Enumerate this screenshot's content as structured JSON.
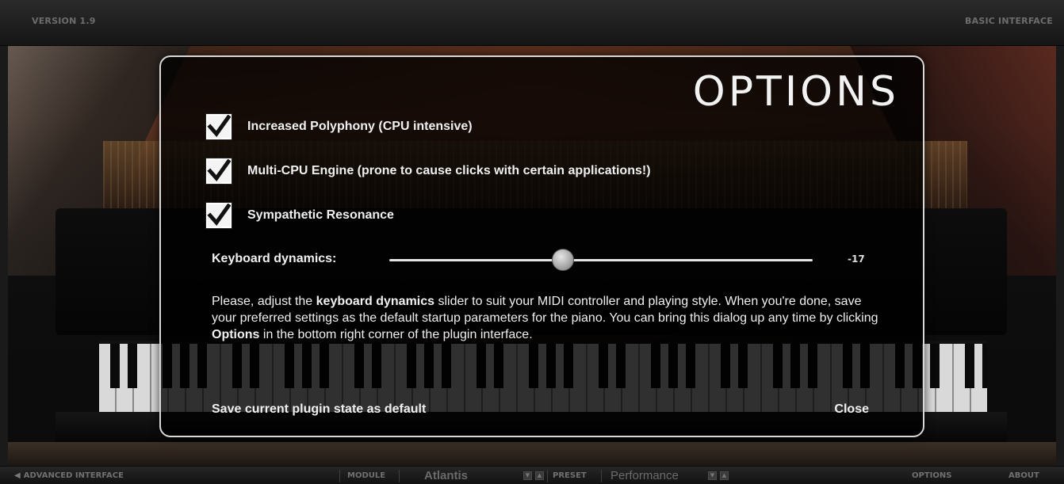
{
  "topbar": {
    "version": "VERSION 1.9",
    "interface_toggle": "BASIC INTERFACE"
  },
  "dialog": {
    "title": "OPTIONS",
    "options": [
      {
        "label": "Increased Polyphony (CPU intensive)",
        "checked": true
      },
      {
        "label": "Multi-CPU Engine (prone to cause clicks with certain applications!)",
        "checked": true
      },
      {
        "label": "Sympathetic Resonance",
        "checked": true
      }
    ],
    "slider": {
      "label": "Keyboard dynamics:",
      "value": "-17",
      "position_fraction": 0.41
    },
    "info": {
      "p1": "Please, adjust the ",
      "b1": "keyboard dynamics",
      "p2": " slider to suit your MIDI controller and playing style. When you're done, save your preferred settings as the default startup parameters for the piano. You can bring this dialog up any time by clicking ",
      "b2": "Options",
      "p3": " in the bottom right corner of the plugin interface."
    },
    "save_label": "Save current plugin state as default",
    "close_label": "Close"
  },
  "bottombar": {
    "advanced": "ADVANCED INTERFACE",
    "module_label": "MODULE",
    "module_value": "Atlantis",
    "preset_label": "PRESET",
    "preset_value": "Performance",
    "options": "OPTIONS",
    "about": "ABOUT"
  },
  "icons": [
    "checkmark-icon",
    "arrow-left-icon",
    "spinner-down-icon",
    "spinner-up-icon"
  ]
}
